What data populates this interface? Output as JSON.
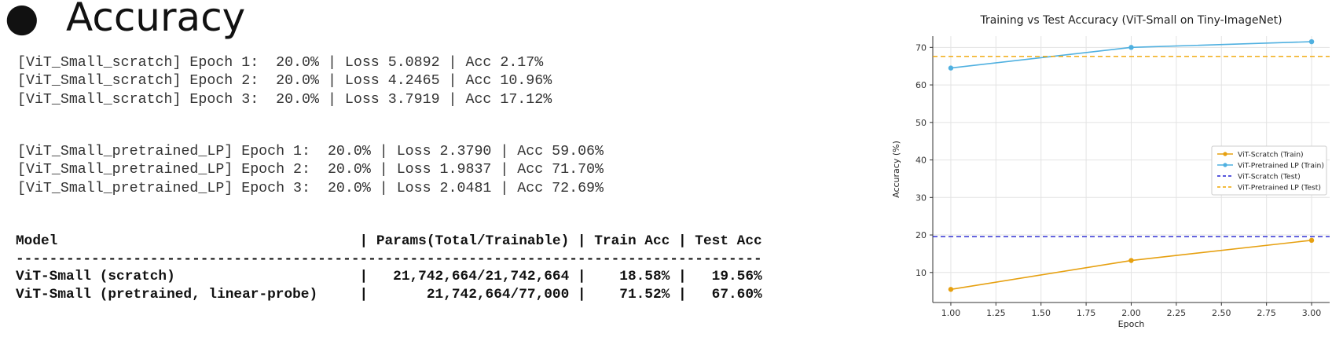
{
  "heading": {
    "bullet": "●",
    "title": "Accuracy"
  },
  "scratch_log": [
    "[ViT_Small_scratch] Epoch 1:  20.0% | Loss 5.0892 | Acc 2.17%",
    "[ViT_Small_scratch] Epoch 2:  20.0% | Loss 4.2465 | Acc 10.96%",
    "[ViT_Small_scratch] Epoch 3:  20.0% | Loss 3.7919 | Acc 17.12%"
  ],
  "pretrained_log": [
    "[ViT_Small_pretrained_LP] Epoch 1:  20.0% | Loss 2.3790 | Acc 59.06%",
    "[ViT_Small_pretrained_LP] Epoch 2:  20.0% | Loss 1.9837 | Acc 71.70%",
    "[ViT_Small_pretrained_LP] Epoch 3:  20.0% | Loss 2.0481 | Acc 72.69%"
  ],
  "summary_table": [
    "Model                                    | Params(Total/Trainable) | Train Acc | Test Acc",
    "-----------------------------------------------------------------------------------------",
    "ViT-Small (scratch)                      |   21,742,664/21,742,664 |    18.58% |   19.56%",
    "ViT-Small (pretrained, linear-probe)     |       21,742,664/77,000 |    71.52% |   67.60%"
  ],
  "chart_data": {
    "type": "line",
    "title": "Training vs Test Accuracy (ViT-Small on Tiny-ImageNet)",
    "xlabel": "Epoch",
    "ylabel": "Accuracy (%)",
    "xlim": [
      0.9,
      3.1
    ],
    "ylim": [
      2,
      73
    ],
    "xticks": [
      "1.00",
      "1.25",
      "1.50",
      "1.75",
      "2.00",
      "2.25",
      "2.50",
      "2.75",
      "3.00"
    ],
    "yticks": [
      "10",
      "20",
      "30",
      "40",
      "50",
      "60",
      "70"
    ],
    "grid": true,
    "legend_position": "center-right",
    "x": [
      1,
      2,
      3
    ],
    "series": [
      {
        "name": "ViT-Scratch (Train)",
        "values": [
          5.5,
          13.2,
          18.58
        ],
        "color": "#e6a010",
        "style": "solid-marker"
      },
      {
        "name": "ViT-Pretrained LP (Train)",
        "values": [
          64.5,
          70.0,
          71.52
        ],
        "color": "#4fb0e0",
        "style": "solid-marker"
      },
      {
        "name": "ViT-Scratch (Test)",
        "value": 19.56,
        "color": "#2020d0",
        "style": "dashed-hline"
      },
      {
        "name": "ViT-Pretrained LP (Test)",
        "value": 67.6,
        "color": "#f0a500",
        "style": "dashed-hline"
      }
    ]
  }
}
